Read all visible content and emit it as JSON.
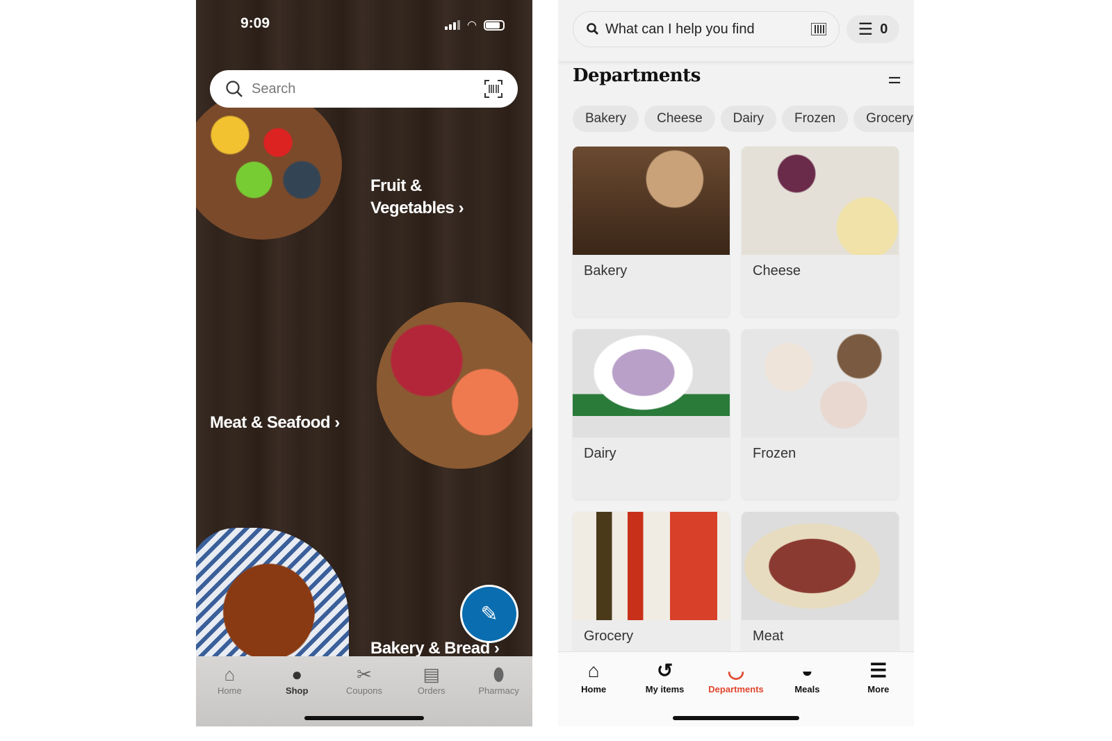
{
  "left": {
    "status_time": "9:09",
    "search_placeholder": "Search",
    "categories": [
      {
        "label_line1": "Fruit &",
        "label_line2": "Vegetables"
      },
      {
        "label": "Meat & Seafood"
      },
      {
        "label": "Bakery & Bread"
      }
    ],
    "nav": [
      {
        "label": "Home",
        "icon": "house-icon"
      },
      {
        "label": "Shop",
        "icon": "apple-icon",
        "active": true
      },
      {
        "label": "Coupons",
        "icon": "scissors-icon"
      },
      {
        "label": "Orders",
        "icon": "receipt-icon"
      },
      {
        "label": "Pharmacy",
        "icon": "pill-icon"
      }
    ],
    "accent": "#0a6db0"
  },
  "right": {
    "search_placeholder": "What can I help you find",
    "list_count": "0",
    "title": "Departments",
    "chips": [
      "Bakery",
      "Cheese",
      "Dairy",
      "Frozen",
      "Grocery"
    ],
    "cards": [
      "Bakery",
      "Cheese",
      "Dairy",
      "Frozen",
      "Grocery",
      "Meat"
    ],
    "nav": [
      {
        "label": "Home",
        "icon": "house-icon"
      },
      {
        "label": "My items",
        "icon": "history-icon"
      },
      {
        "label": "Departments",
        "icon": "departments-icon",
        "active": true
      },
      {
        "label": "Meals",
        "icon": "whisk-bowl-icon"
      },
      {
        "label": "More",
        "icon": "menu-icon"
      }
    ],
    "accent": "#e0452c"
  }
}
